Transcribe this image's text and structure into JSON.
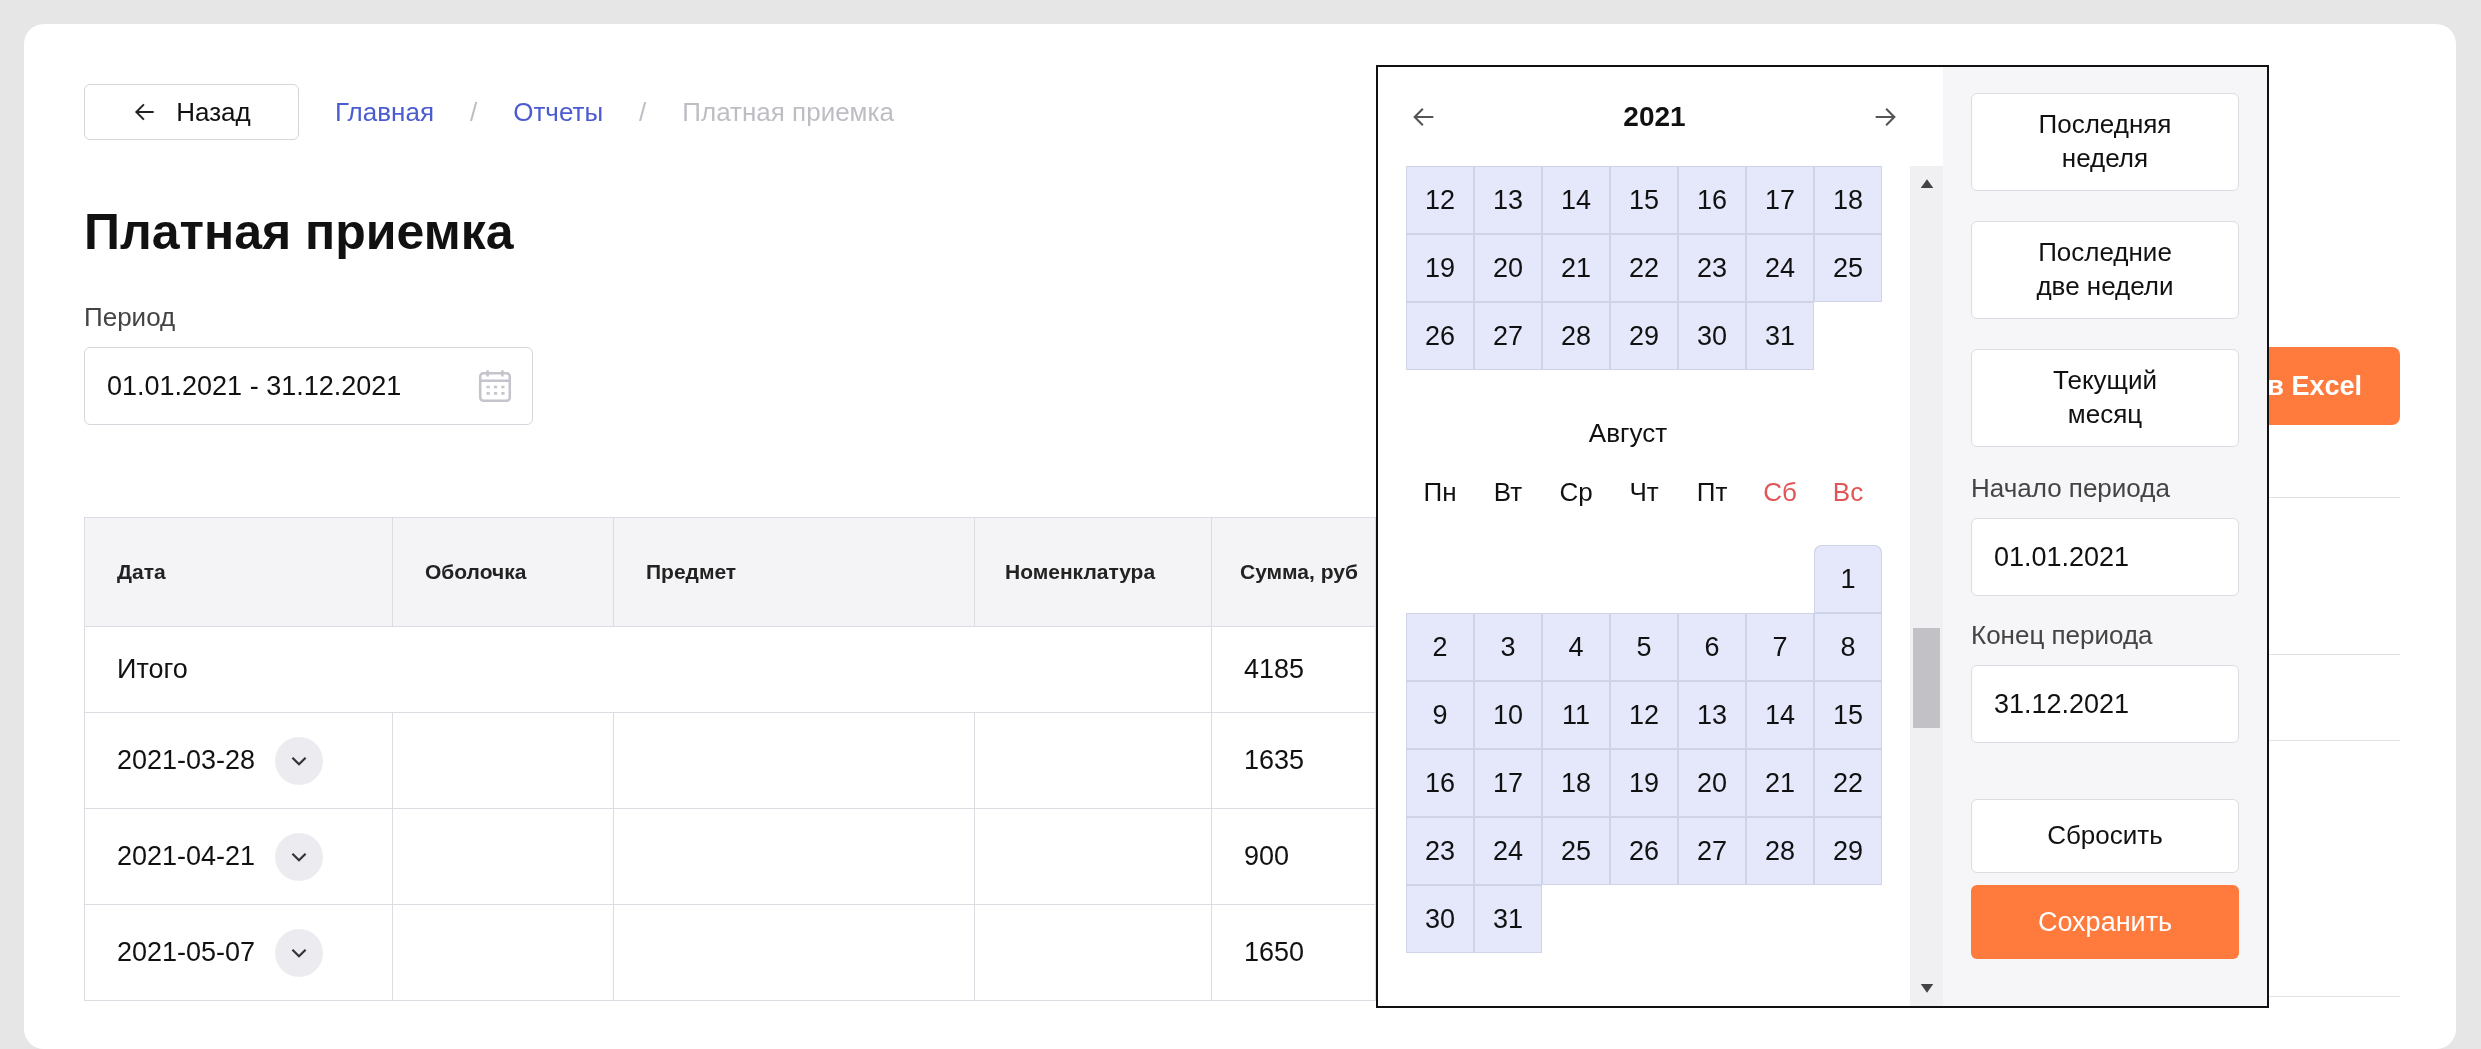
{
  "back_button": {
    "label": "Назад"
  },
  "breadcrumbs": [
    {
      "label": "Главная",
      "current": false
    },
    {
      "label": "Отчеты",
      "current": false
    },
    {
      "label": "Платная приемка",
      "current": true
    }
  ],
  "breadcrumb_separators": [
    "/",
    "/"
  ],
  "title": "Платная приемка",
  "period": {
    "label": "Период",
    "value": "01.01.2021 - 31.12.2021"
  },
  "export_button": {
    "label": "в Excel"
  },
  "table": {
    "columns": [
      "Дата",
      "Оболочка",
      "Предмет",
      "Номенклатура",
      "Сумма, руб"
    ],
    "total": {
      "label": "Итого",
      "sum": "4185"
    },
    "rows": [
      {
        "date": "2021-03-28",
        "expanded": false,
        "sum": "1635"
      },
      {
        "date": "2021-04-21",
        "expanded": false,
        "sum": "900"
      },
      {
        "date": "2021-05-07",
        "expanded": false,
        "sum": "1650"
      }
    ]
  },
  "calendar": {
    "year": "2021",
    "months": [
      {
        "in_range": true,
        "weeks": [
          {
            "days": [
              "12",
              "13",
              "14",
              "15",
              "16",
              "17",
              "18"
            ]
          },
          {
            "days": [
              "19",
              "20",
              "21",
              "22",
              "23",
              "24",
              "25"
            ]
          },
          {
            "days": [
              "26",
              "27",
              "28",
              "29",
              "30",
              "31"
            ]
          }
        ]
      },
      {
        "name": "Август",
        "in_range": true,
        "weekdays": [
          {
            "label": "Пн",
            "weekend": false
          },
          {
            "label": "Вт",
            "weekend": false
          },
          {
            "label": "Ср",
            "weekend": false
          },
          {
            "label": "Чт",
            "weekend": false
          },
          {
            "label": "Пт",
            "weekend": false
          },
          {
            "label": "Сб",
            "weekend": true
          },
          {
            "label": "Вс",
            "weekend": true
          }
        ],
        "weeks": [
          {
            "right_aligned": true,
            "days": [
              "1"
            ]
          },
          {
            "days": [
              "2",
              "3",
              "4",
              "5",
              "6",
              "7",
              "8"
            ]
          },
          {
            "days": [
              "9",
              "10",
              "11",
              "12",
              "13",
              "14",
              "15"
            ]
          },
          {
            "days": [
              "16",
              "17",
              "18",
              "19",
              "20",
              "21",
              "22"
            ]
          },
          {
            "days": [
              "23",
              "24",
              "25",
              "26",
              "27",
              "28",
              "29"
            ]
          },
          {
            "days": [
              "30",
              "31"
            ]
          }
        ]
      }
    ]
  },
  "presets": [
    {
      "label": "Последняя неделя"
    },
    {
      "label": "Последние две недели"
    },
    {
      "label": "Текущий месяц"
    }
  ],
  "start": {
    "label": "Начало периода",
    "value": "01.01.2021"
  },
  "end": {
    "label": "Конец периода",
    "value": "31.12.2021"
  },
  "reset_button": {
    "label": "Сбросить"
  },
  "save_button": {
    "label": "Сохранить"
  }
}
